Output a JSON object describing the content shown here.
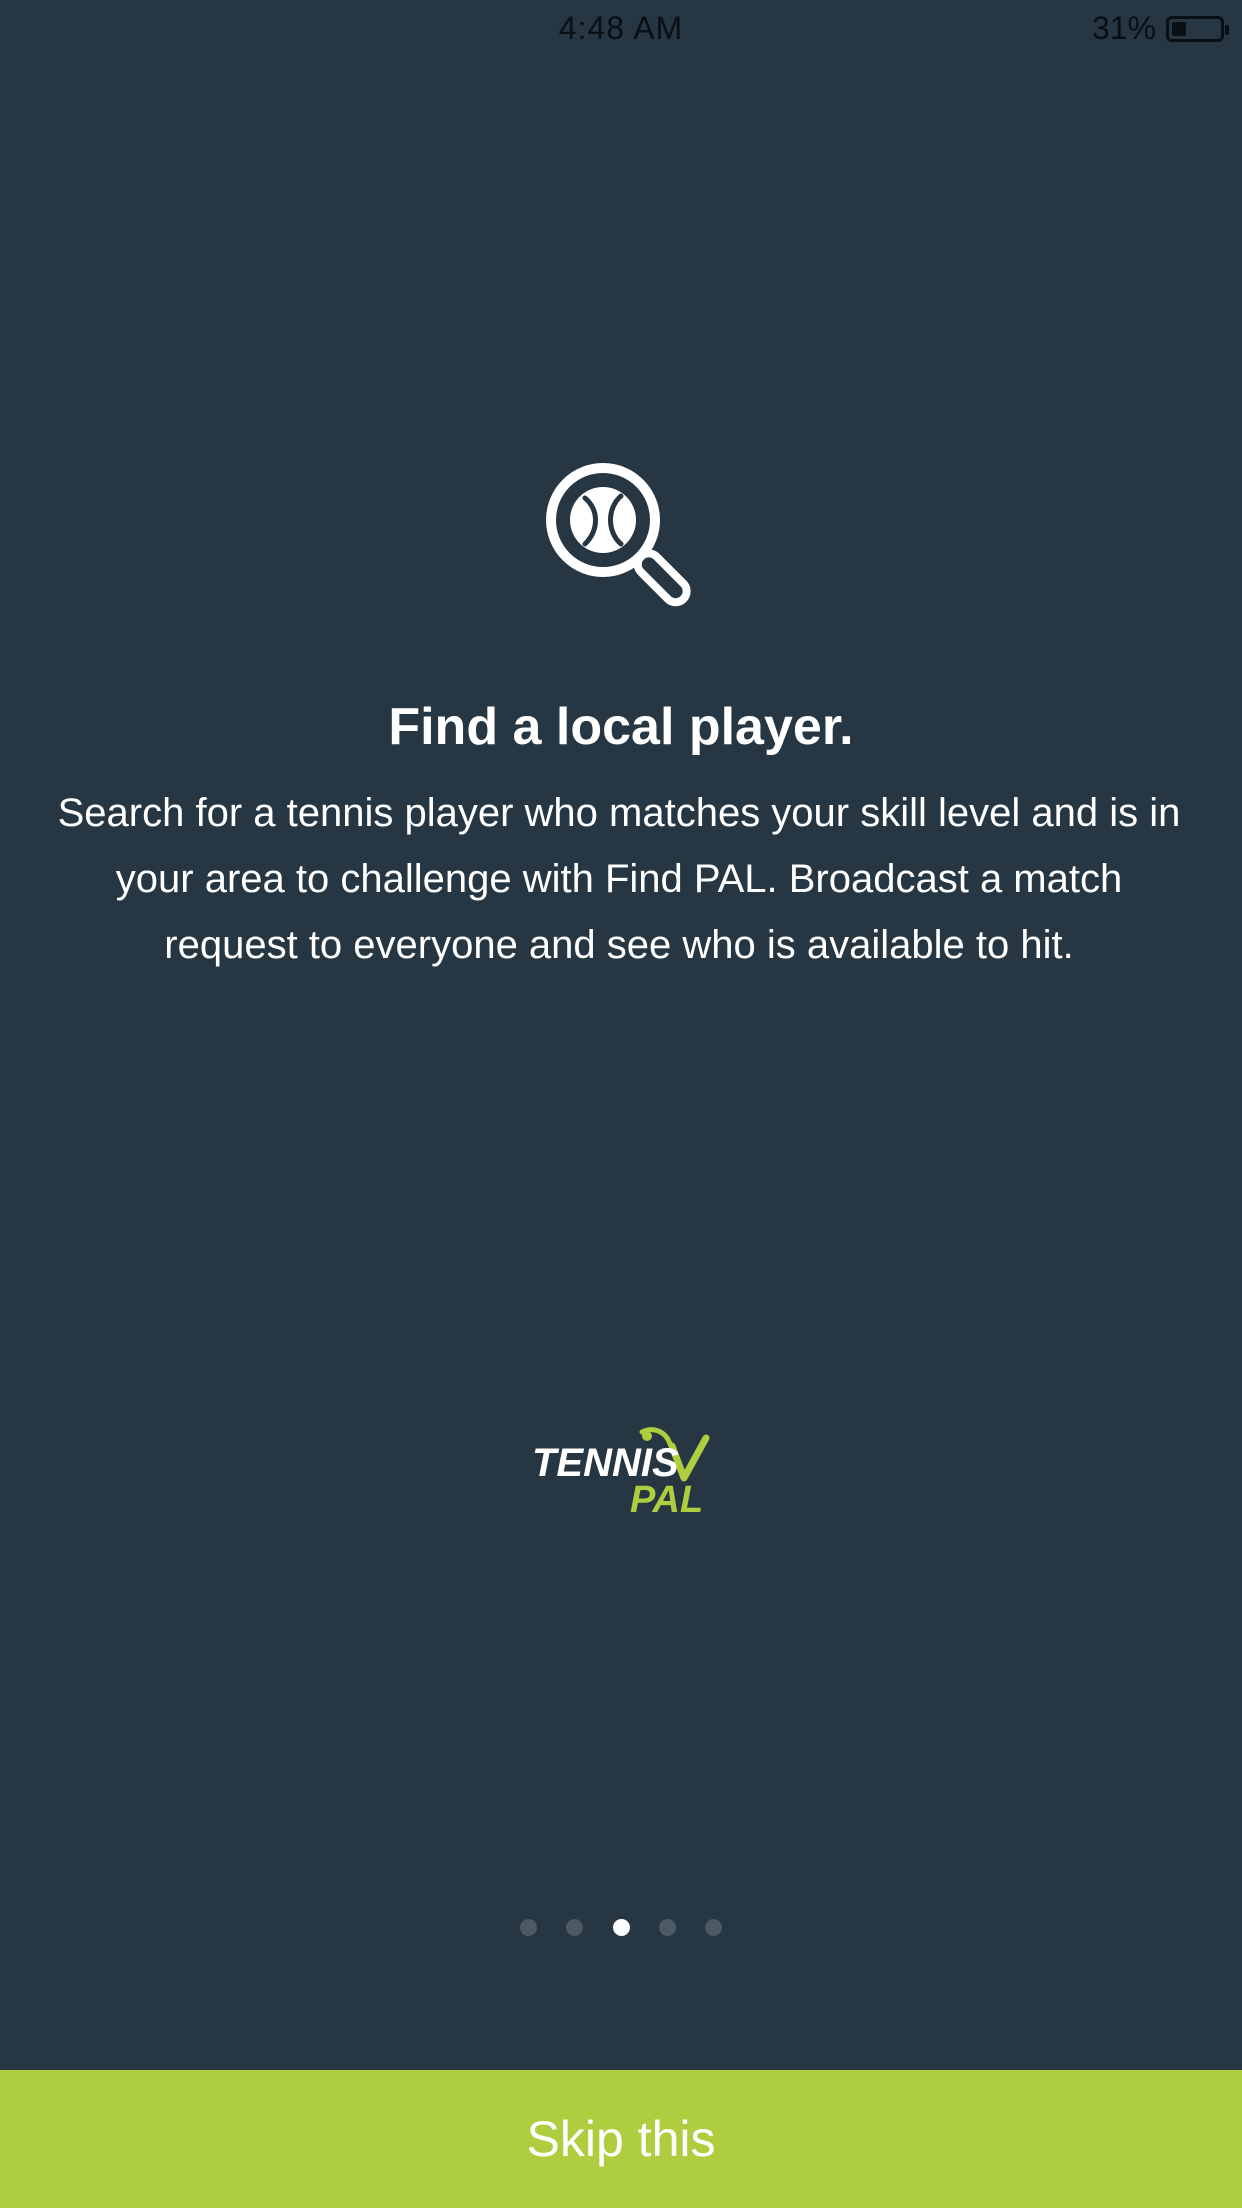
{
  "status_bar": {
    "time": "4:48 AM",
    "battery_percent": "31%",
    "battery_level": 0.31
  },
  "onboarding": {
    "icon": "magnifier-tennis-ball-icon",
    "title": "Find a local player.",
    "description": "Search for a tennis player who matches your skill level and is in your area to challenge with Find PAL. Broadcast a match request to everyone and see who is available to hit."
  },
  "logo": {
    "word_top": "TENNIS",
    "word_bottom": "PAL",
    "colors": {
      "top": "#ffffff",
      "bottom": "#aecd3f"
    }
  },
  "page_indicator": {
    "count": 5,
    "active_index": 2
  },
  "skip_button": {
    "label": "Skip this"
  },
  "colors": {
    "background": "#263642",
    "accent": "#aecd3f",
    "dot_inactive": "#4c5a65",
    "dot_active": "#ffffff"
  }
}
